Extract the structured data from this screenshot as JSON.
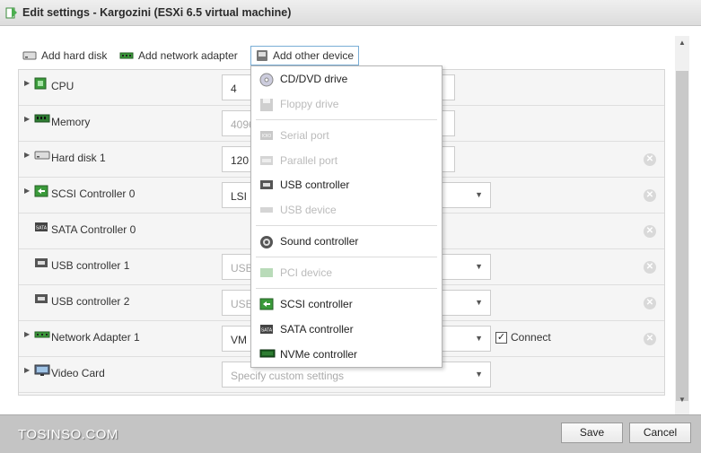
{
  "window": {
    "title": "Edit settings - Kargozini (ESXi 6.5 virtual machine)"
  },
  "toolbar": {
    "add_hard_disk": "Add hard disk",
    "add_network_adapter": "Add network adapter",
    "add_other_device": "Add other device"
  },
  "hardware": [
    {
      "label": "CPU",
      "icon": "cpu-icon",
      "value": "4",
      "value_disabled": false,
      "has_expand": true,
      "has_dropdown": false,
      "removable": false
    },
    {
      "label": "Memory",
      "icon": "memory-icon",
      "value": "4096",
      "value_disabled": true,
      "has_expand": true,
      "has_dropdown": false,
      "removable": false
    },
    {
      "label": "Hard disk 1",
      "icon": "hard-disk-icon",
      "value": "120",
      "value_disabled": false,
      "has_expand": true,
      "has_dropdown": false,
      "removable": true
    },
    {
      "label": "SCSI Controller 0",
      "icon": "scsi-controller-icon",
      "value": "LSI",
      "value_disabled": false,
      "has_expand": true,
      "has_dropdown": true,
      "removable": true
    },
    {
      "label": "SATA Controller 0",
      "icon": "sata-controller-icon",
      "value": "",
      "value_disabled": false,
      "has_expand": false,
      "has_dropdown": false,
      "removable": true
    },
    {
      "label": "USB controller 1",
      "icon": "usb-icon",
      "value": "USB",
      "value_disabled": true,
      "has_expand": false,
      "has_dropdown": true,
      "removable": true
    },
    {
      "label": "USB controller 2",
      "icon": "usb-icon",
      "value": "USB",
      "value_disabled": true,
      "has_expand": false,
      "has_dropdown": true,
      "removable": true
    },
    {
      "label": "Network Adapter 1",
      "icon": "network-adapter-icon",
      "value": "VM N",
      "value_disabled": false,
      "has_expand": true,
      "has_dropdown": true,
      "removable": true,
      "connect_label": "Connect",
      "connect_checked": true
    },
    {
      "label": "Video Card",
      "icon": "video-card-icon",
      "value": "Specify custom settings",
      "value_disabled": true,
      "has_expand": true,
      "has_dropdown": true,
      "removable": false
    }
  ],
  "other_device_menu": {
    "items": [
      {
        "label": "CD/DVD drive",
        "icon": "cd-dvd-icon",
        "enabled": true
      },
      {
        "label": "Floppy drive",
        "icon": "floppy-icon",
        "enabled": false
      },
      {
        "label": "Serial port",
        "icon": "serial-port-icon",
        "enabled": false
      },
      {
        "label": "Parallel port",
        "icon": "parallel-port-icon",
        "enabled": false
      },
      {
        "label": "USB controller",
        "icon": "usb-icon",
        "enabled": true
      },
      {
        "label": "USB device",
        "icon": "usb-device-icon",
        "enabled": false
      },
      {
        "label": "Sound controller",
        "icon": "sound-icon",
        "enabled": true
      },
      {
        "label": "PCI device",
        "icon": "pci-icon",
        "enabled": false
      },
      {
        "label": "SCSI controller",
        "icon": "scsi-controller-icon",
        "enabled": true
      },
      {
        "label": "SATA controller",
        "icon": "sata-controller-icon",
        "enabled": true
      },
      {
        "label": "NVMe controller",
        "icon": "nvme-icon",
        "enabled": true
      }
    ]
  },
  "footer": {
    "watermark": "TOSINSO.COM",
    "save_label": "Save",
    "cancel_label": "Cancel"
  },
  "colors": {
    "title_bar": "#dcdcdc",
    "footer": "#c4c4c4",
    "accent_border": "#7aaed6",
    "icon_green": "#3a9a3a"
  }
}
